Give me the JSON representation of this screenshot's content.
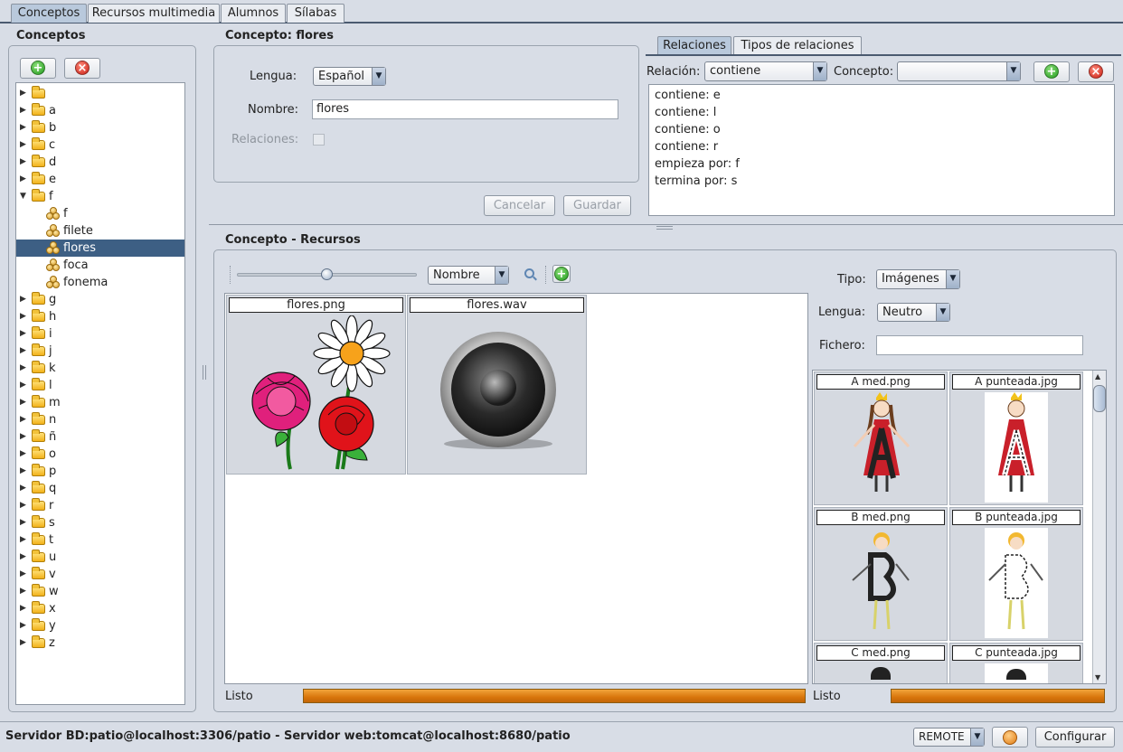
{
  "tabs": [
    "Conceptos",
    "Recursos multimedia",
    "Alumnos",
    "Sílabas"
  ],
  "left": {
    "title": "Conceptos",
    "tree": [
      {
        "label": "",
        "type": "folder",
        "expanded": false
      },
      {
        "label": "a",
        "type": "folder",
        "expanded": false
      },
      {
        "label": "b",
        "type": "folder",
        "expanded": false
      },
      {
        "label": "c",
        "type": "folder",
        "expanded": false
      },
      {
        "label": "d",
        "type": "folder",
        "expanded": false
      },
      {
        "label": "e",
        "type": "folder",
        "expanded": false
      },
      {
        "label": "f",
        "type": "folder",
        "expanded": true
      },
      {
        "label": "f",
        "type": "leaf"
      },
      {
        "label": "filete",
        "type": "leaf"
      },
      {
        "label": "flores",
        "type": "leaf",
        "selected": true
      },
      {
        "label": "foca",
        "type": "leaf"
      },
      {
        "label": "fonema",
        "type": "leaf"
      },
      {
        "label": "g",
        "type": "folder",
        "expanded": false
      },
      {
        "label": "h",
        "type": "folder",
        "expanded": false
      },
      {
        "label": "i",
        "type": "folder",
        "expanded": false
      },
      {
        "label": "j",
        "type": "folder",
        "expanded": false
      },
      {
        "label": "k",
        "type": "folder",
        "expanded": false
      },
      {
        "label": "l",
        "type": "folder",
        "expanded": false
      },
      {
        "label": "m",
        "type": "folder",
        "expanded": false
      },
      {
        "label": "n",
        "type": "folder",
        "expanded": false
      },
      {
        "label": "ñ",
        "type": "folder",
        "expanded": false
      },
      {
        "label": "o",
        "type": "folder",
        "expanded": false
      },
      {
        "label": "p",
        "type": "folder",
        "expanded": false
      },
      {
        "label": "q",
        "type": "folder",
        "expanded": false
      },
      {
        "label": "r",
        "type": "folder",
        "expanded": false
      },
      {
        "label": "s",
        "type": "folder",
        "expanded": false
      },
      {
        "label": "t",
        "type": "folder",
        "expanded": false
      },
      {
        "label": "u",
        "type": "folder",
        "expanded": false
      },
      {
        "label": "v",
        "type": "folder",
        "expanded": false
      },
      {
        "label": "w",
        "type": "folder",
        "expanded": false
      },
      {
        "label": "x",
        "type": "folder",
        "expanded": false
      },
      {
        "label": "y",
        "type": "folder",
        "expanded": false
      },
      {
        "label": "z",
        "type": "folder",
        "expanded": false
      }
    ]
  },
  "concept": {
    "title": "Concepto: flores",
    "lengua_label": "Lengua:",
    "lengua_value": "Español",
    "nombre_label": "Nombre:",
    "nombre_value": "flores",
    "relaciones_label": "Relaciones:",
    "cancel_label": "Cancelar",
    "save_label": "Guardar"
  },
  "relations": {
    "tabs": [
      "Relaciones",
      "Tipos de relaciones"
    ],
    "relacion_label": "Relación:",
    "relacion_value": "contiene",
    "concepto_label": "Concepto:",
    "concepto_value": "",
    "items": [
      "contiene: e",
      "contiene: l",
      "contiene: o",
      "contiene: r",
      "empieza por: f",
      "termina por: s"
    ]
  },
  "resources": {
    "title": "Concepto - Recursos",
    "sort_value": "Nombre",
    "slider_fraction": 0.5,
    "items": [
      {
        "name": "flores.png",
        "kind": "image"
      },
      {
        "name": "flores.wav",
        "kind": "audio"
      }
    ],
    "status_left": "Listo",
    "status_right": "Listo",
    "tipo_label": "Tipo:",
    "tipo_value": "Imágenes",
    "lengua_label": "Lengua:",
    "lengua_value": "Neutro",
    "fichero_label": "Fichero:",
    "fichero_value": "",
    "gallery": [
      "A med.png",
      "A punteada.jpg",
      "B med.png",
      "B punteada.jpg",
      "C med.png",
      "C punteada.jpg"
    ]
  },
  "statusbar": {
    "text": "Servidor BD:patio@localhost:3306/patio - Servidor web:tomcat@localhost:8680/patio",
    "mode_value": "REMOTE",
    "configure_label": "Configurar"
  },
  "colors": {
    "selection": "#3d5f84",
    "progress": "#d8750c",
    "background": "#d8dde6"
  }
}
